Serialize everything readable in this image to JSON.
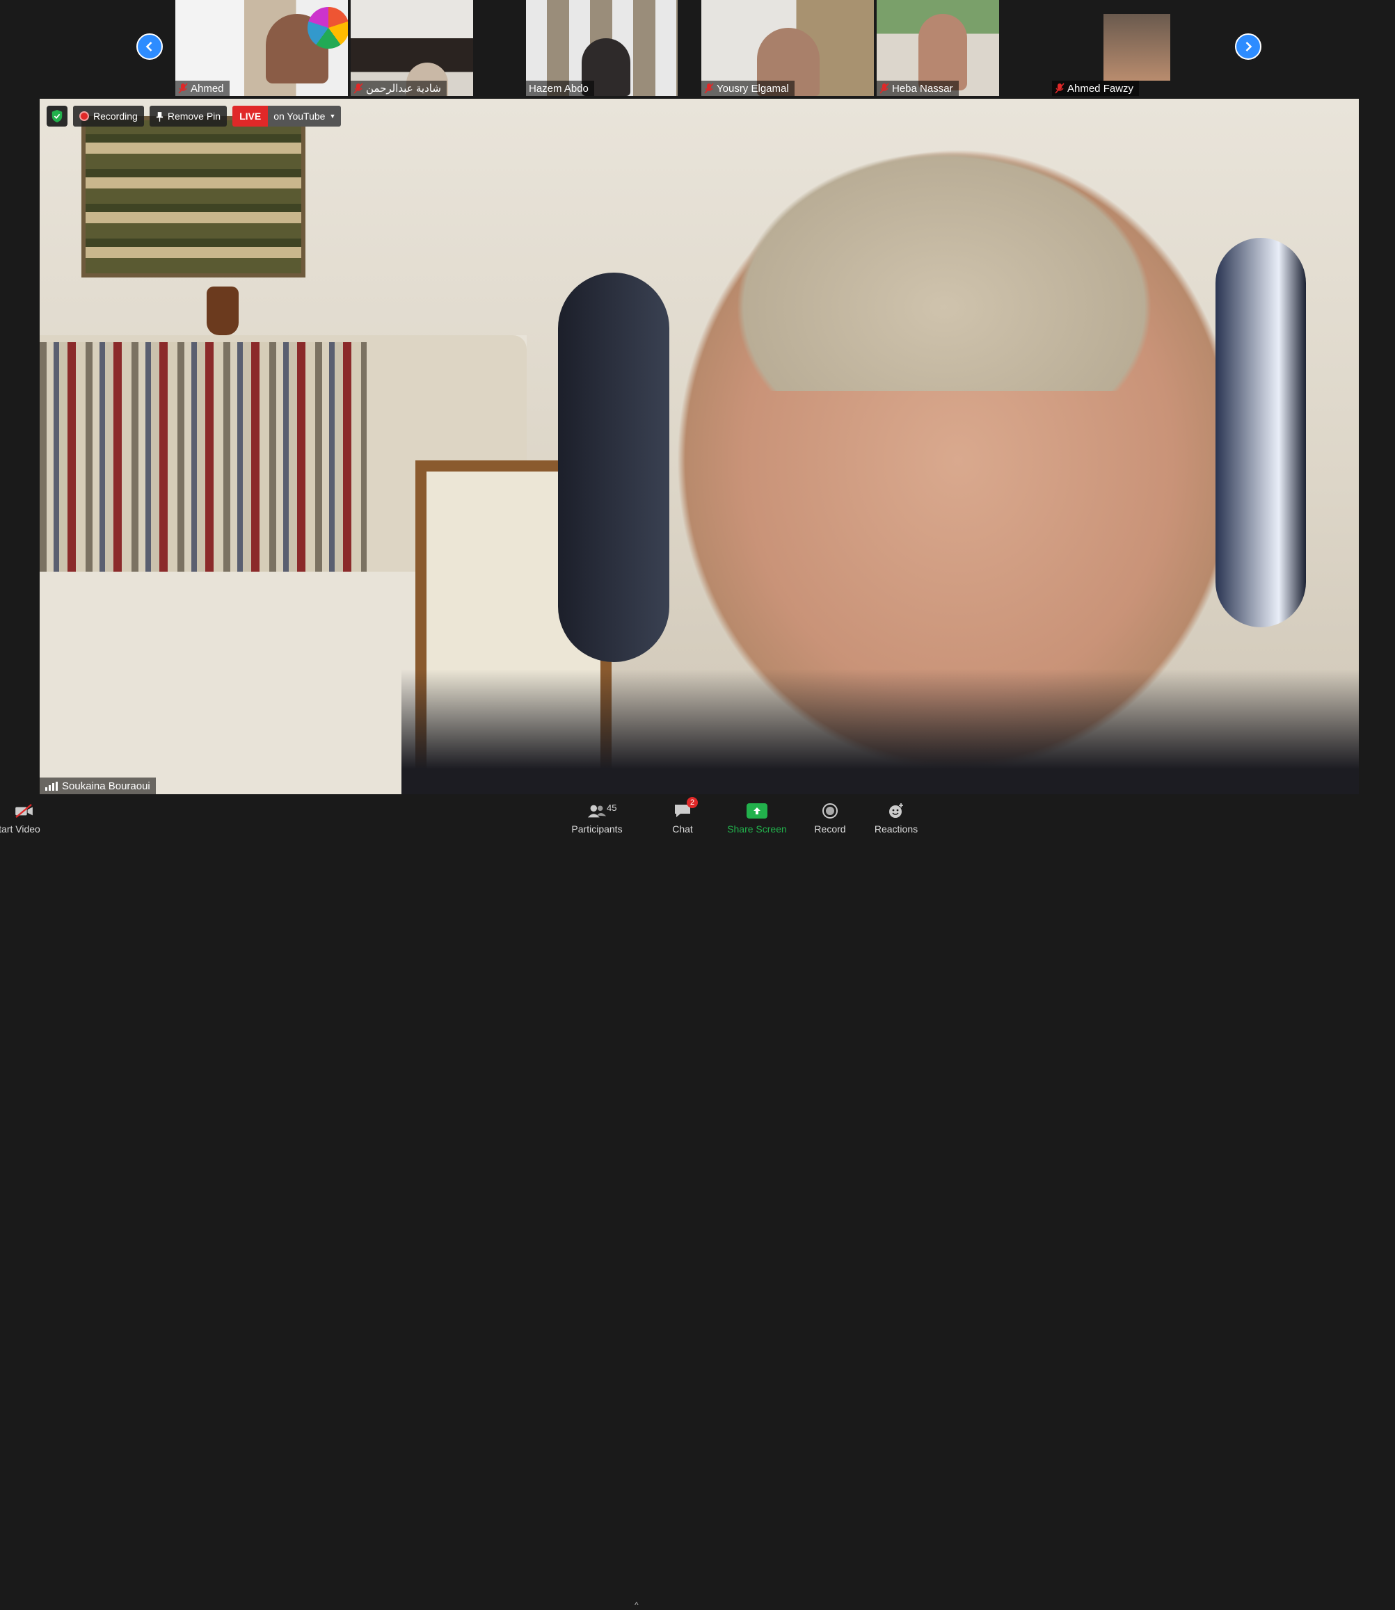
{
  "participants": [
    {
      "name": "Ahmed",
      "muted": true
    },
    {
      "name": "شادية عبدالرحمن",
      "muted": true
    },
    {
      "name": "Hazem Abdo",
      "muted": false
    },
    {
      "name": "Yousry Elgamal",
      "muted": true
    },
    {
      "name": "Heba Nassar",
      "muted": true
    },
    {
      "name": "Ahmed Fawzy",
      "muted": true
    }
  ],
  "overlay": {
    "recording_label": "Recording",
    "remove_pin_label": "Remove Pin",
    "live_label": "LIVE",
    "youtube_label": "on YouTube"
  },
  "speaker": {
    "name": "Soukaina Bouraoui"
  },
  "toolbar": {
    "start_video_label": "tart Video",
    "participants_label": "Participants",
    "participants_count": "45",
    "chat_label": "Chat",
    "chat_badge": "2",
    "share_screen_label": "Share Screen",
    "record_label": "Record",
    "reactions_label": "Reactions"
  },
  "colors": {
    "accent_blue": "#2d8cff",
    "live_red": "#e02828",
    "share_green": "#22b14c",
    "background": "#1a1a1a"
  }
}
